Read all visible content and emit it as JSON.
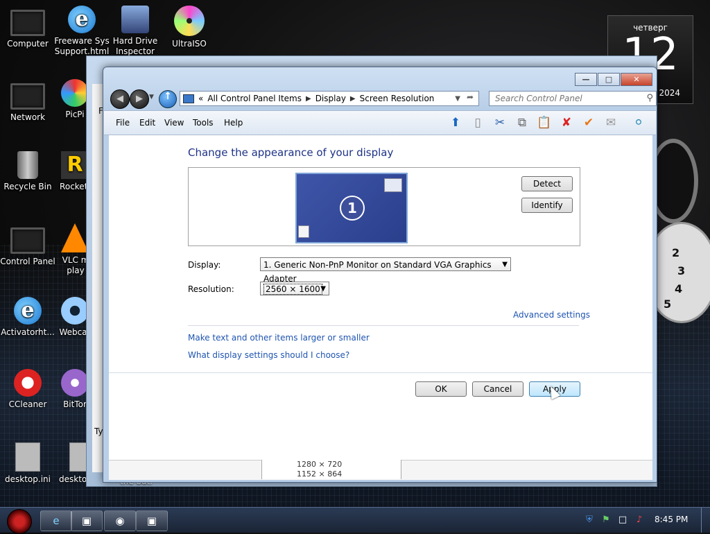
{
  "desktop": {
    "icons": [
      {
        "label": "Computer",
        "name": "computer"
      },
      {
        "label": "Freeware Sys Support.html",
        "name": "freeware-sys-support"
      },
      {
        "label": "Hard Drive Inspector",
        "name": "hard-drive-inspector"
      },
      {
        "label": "UltraISO",
        "name": "ultraiso"
      },
      {
        "label": "Network",
        "name": "network"
      },
      {
        "label": "PicPi",
        "name": "picpick"
      },
      {
        "label": "Recycle Bin",
        "name": "recycle-bin"
      },
      {
        "label": "RocketI",
        "name": "rocketdock"
      },
      {
        "label": "Control Panel",
        "name": "control-panel"
      },
      {
        "label": "VLC m play",
        "name": "vlc"
      },
      {
        "label": "Activatorht...",
        "name": "activator"
      },
      {
        "label": "Webcar",
        "name": "webcam"
      },
      {
        "label": "CCleaner",
        "name": "ccleaner"
      },
      {
        "label": "BitTor",
        "name": "bittorrent"
      },
      {
        "label": "desktop.ini",
        "name": "desktop-ini-1"
      },
      {
        "label": "desktop.ini",
        "name": "desktop-ini-2"
      }
    ],
    "calendar": {
      "day": "четверг",
      "date": "12",
      "year": "2024"
    },
    "clock_numbers": [
      "2",
      "3",
      "4",
      "5"
    ]
  },
  "window": {
    "breadcrumb": [
      "All Control Panel Items",
      "Display",
      "Screen Resolution"
    ],
    "breadcrumb_prefix": "«",
    "search_placeholder": "Search Control Panel",
    "menu": [
      "File",
      "Edit",
      "View",
      "Tools",
      "Help"
    ],
    "heading": "Change the appearance of your display",
    "monitor_number": "1",
    "detect_label": "Detect",
    "identify_label": "Identify",
    "display_label": "Display:",
    "display_value": "1. Generic Non-PnP Monitor on Standard VGA Graphics Adapter",
    "resolution_label": "Resolution:",
    "resolution_value": "2560 × 1600",
    "advanced_link": "Advanced settings",
    "link_text_size": "Make text and other items larger or smaller",
    "link_help": "What display settings should I choose?",
    "ok_label": "OK",
    "cancel_label": "Cancel",
    "apply_label": "Apply",
    "list_fragment": [
      "1280 × 720",
      "1152 × 864"
    ],
    "back_fragment_top": "F",
    "back_fragment_bottom": "Ty",
    "back_fragment_bat": "the bat."
  },
  "taskbar": {
    "time": "8:45 PM"
  }
}
